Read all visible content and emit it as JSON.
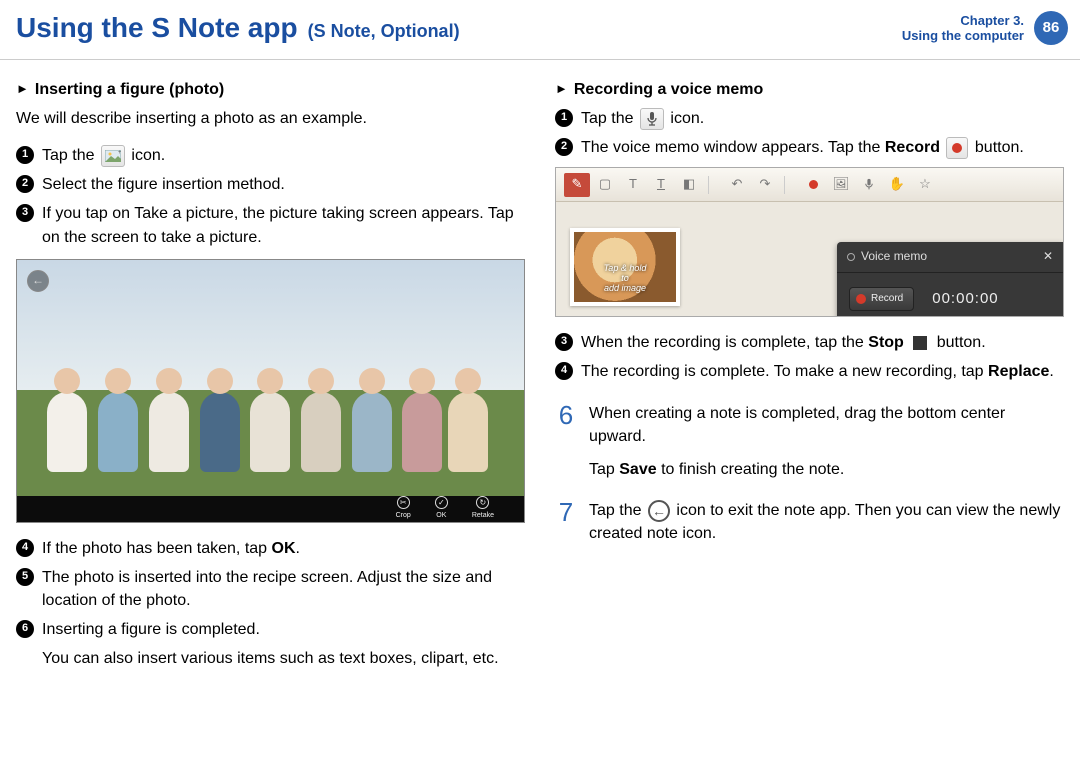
{
  "header": {
    "title_main": "Using the S Note app",
    "title_sub": "(S Note, Optional)",
    "chapter_line1": "Chapter 3.",
    "chapter_line2": "Using the computer",
    "page_number": "86"
  },
  "left": {
    "heading": "Inserting a figure (photo)",
    "intro": "We will describe inserting a photo as an example.",
    "steps_top": [
      {
        "n": "1",
        "pre": "Tap the ",
        "post": " icon."
      },
      {
        "n": "2",
        "text": "Select the figure insertion method."
      },
      {
        "n": "3",
        "text": "If you tap on Take a picture, the picture taking screen appears. Tap on the screen to take a picture."
      }
    ],
    "photo_bar": {
      "crop": "Crop",
      "ok": "OK",
      "retake": "Retake"
    },
    "steps_bottom": [
      {
        "n": "4",
        "pre": "If the photo has been taken, tap ",
        "bold": "OK",
        "post": "."
      },
      {
        "n": "5",
        "text": "The photo is inserted into the recipe screen. Adjust the size and location of the photo."
      },
      {
        "n": "6",
        "text": "Inserting a figure is completed."
      }
    ],
    "footnote": "You can also insert various items such as text boxes, clipart, etc."
  },
  "right": {
    "heading": "Recording a voice memo",
    "steps_top": [
      {
        "n": "1",
        "pre": "Tap the ",
        "post": " icon."
      },
      {
        "n": "2",
        "pre": "The voice memo window appears. Tap the ",
        "bold": "Record",
        "post": " button."
      }
    ],
    "voice_shot": {
      "popup_title": "Voice memo",
      "record_label": "Record",
      "time": "00:00:00",
      "thumb_label1": "Tap & hold to",
      "thumb_label2": "add image"
    },
    "steps_mid": [
      {
        "n": "3",
        "pre": "When the recording is complete, tap the ",
        "bold": "Stop",
        "post": " button."
      },
      {
        "n": "4",
        "pre": "The recording is complete. To make a new recording, tap ",
        "bold": "Replace",
        "post": "."
      }
    ],
    "big_steps": [
      {
        "n": "6",
        "line1": "When creating a note is completed, drag the bottom center upward.",
        "line2_pre": "Tap ",
        "line2_bold": "Save",
        "line2_post": " to finish creating the note."
      },
      {
        "n": "7",
        "pre": "Tap the ",
        "post": " icon to exit the note app. Then you can view the newly created note icon."
      }
    ]
  }
}
